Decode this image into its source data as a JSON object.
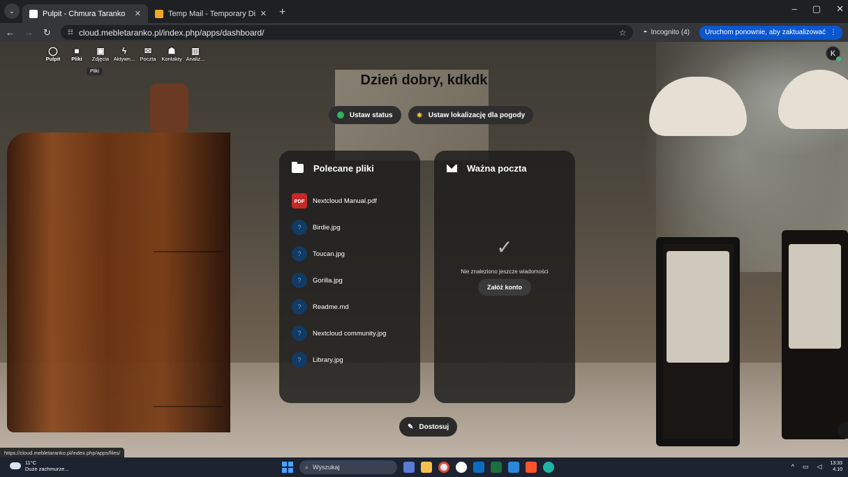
{
  "browser": {
    "tabs": [
      {
        "title": "Pulpit - Chmura Taranko",
        "active": true
      },
      {
        "title": "Temp Mail - Temporary Dispos",
        "active": false
      }
    ],
    "new_tab_label": "+",
    "url": "cloud.mebletaranko.pl/index.php/apps/dashboard/",
    "incognito_label": "Incognito (4)",
    "update_button_label": "Uruchom ponownie, aby zaktualizować"
  },
  "nextcloud": {
    "apps": [
      {
        "label": "Pulpit",
        "icon": "dashboard-icon"
      },
      {
        "label": "Pliki",
        "icon": "folder-icon"
      },
      {
        "label": "Zdjęcia",
        "icon": "image-icon"
      },
      {
        "label": "Aktywn...",
        "icon": "lightning-icon"
      },
      {
        "label": "Poczta",
        "icon": "mail-icon"
      },
      {
        "label": "Kontakty",
        "icon": "contacts-icon"
      },
      {
        "label": "Analiz...",
        "icon": "chart-icon"
      }
    ],
    "tooltip": "Pliki",
    "avatar_letter": "K",
    "greeting": "Dzień dobry, kdkdk",
    "set_status_label": "Ustaw status",
    "set_weather_label": "Ustaw lokalizację dla pogody",
    "files_widget": {
      "title": "Polecane pliki",
      "files": [
        {
          "name": "Nextcloud Manual.pdf",
          "type": "pdf",
          "badge": "PDF"
        },
        {
          "name": "Birdie.jpg",
          "type": "unknown",
          "badge": "?"
        },
        {
          "name": "Toucan.jpg",
          "type": "unknown",
          "badge": "?"
        },
        {
          "name": "Gorilla.jpg",
          "type": "unknown",
          "badge": "?"
        },
        {
          "name": "Readme.md",
          "type": "unknown",
          "badge": "?"
        },
        {
          "name": "Nextcloud community.jpg",
          "type": "unknown",
          "badge": "?"
        },
        {
          "name": "Library.jpg",
          "type": "unknown",
          "badge": "?"
        }
      ]
    },
    "mail_widget": {
      "title": "Ważna poczta",
      "empty_text": "Nie znaleziono jeszcze wiadomości",
      "create_account_label": "Załóż konto"
    },
    "customize_label": "Dostosuj"
  },
  "status_bar_url": "https://cloud.mebletaranko.pl/index.php/apps/files/",
  "taskbar": {
    "weather_temp": "11°C",
    "weather_desc": "Duże zachmurze...",
    "search_placeholder": "Wyszukaj",
    "time": "13:33",
    "date": "4.10"
  }
}
